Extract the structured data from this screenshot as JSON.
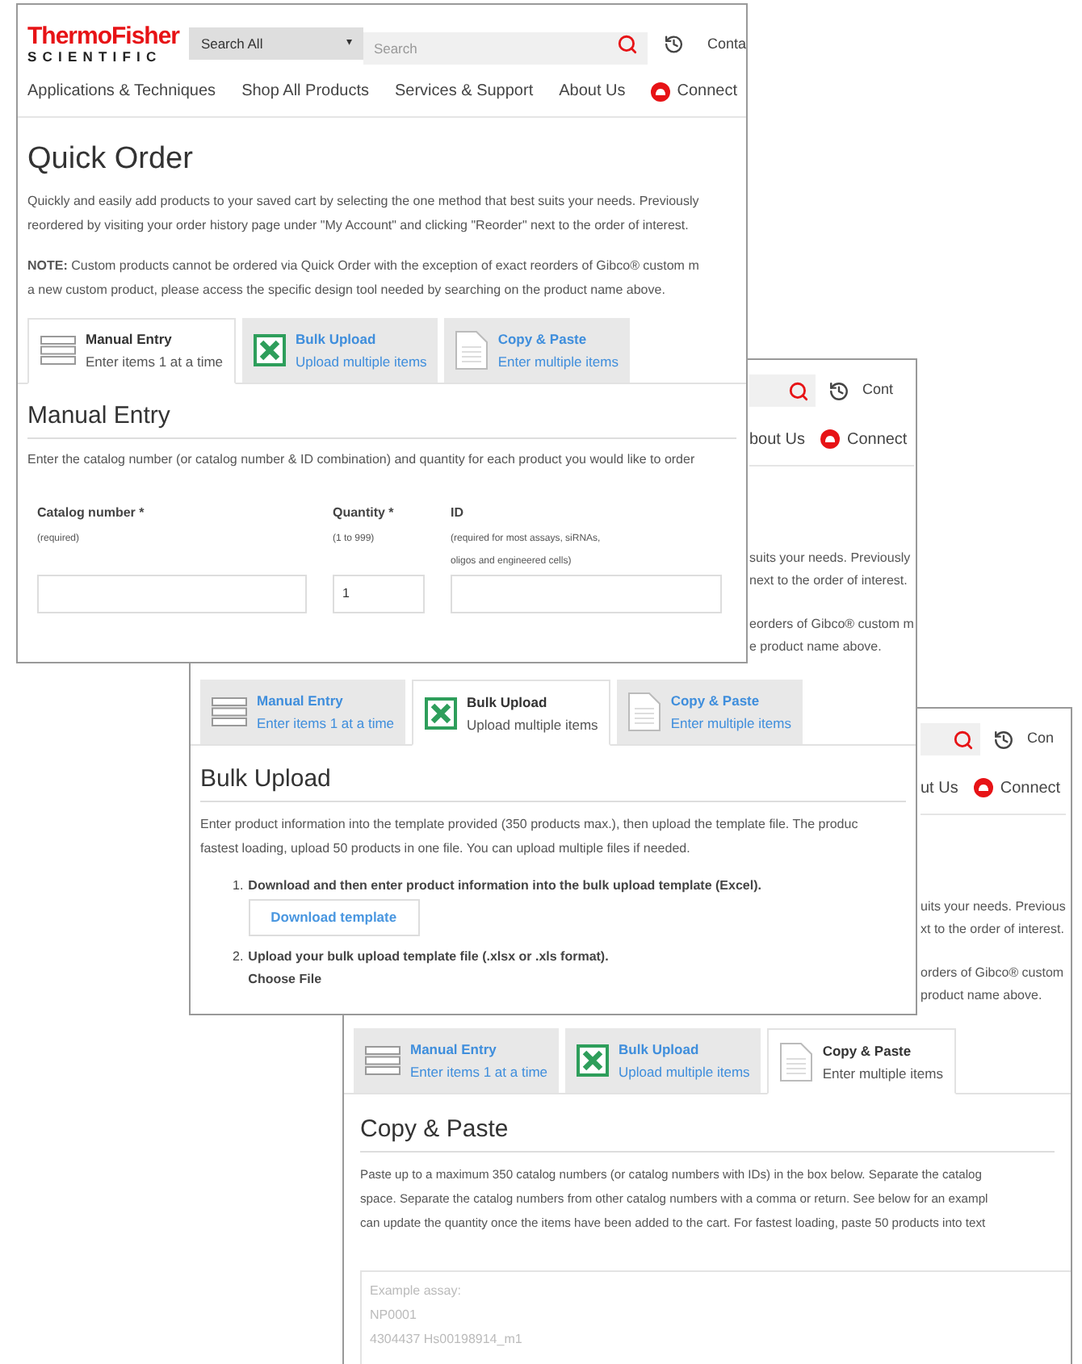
{
  "quick_order_window": {
    "logo": {
      "brand": "ThermoFisher",
      "sub": "SCIENTIFIC"
    },
    "search": {
      "scope": "Search All",
      "caret": "▾",
      "placeholder": "Search"
    },
    "header_link": "Conta",
    "nav": [
      {
        "label": "Applications & Techniques",
        "kind": "link"
      },
      {
        "label": "Shop All Products",
        "kind": "link"
      },
      {
        "label": "Services & Support",
        "kind": "link"
      },
      {
        "label": "About Us",
        "kind": "link"
      },
      {
        "label": "Connect",
        "kind": "connect"
      }
    ],
    "title": "Quick Order",
    "intro_lines": [
      "Quickly and easily add products to your saved cart by selecting the one method that best suits your needs. Previously",
      "reordered by visiting your order history page under \"My Account\" and clicking \"Reorder\" next to the order of interest."
    ],
    "note_lines": [
      "**NOTE:** Custom products cannot be ordered via Quick Order with the exception of exact reorders of Gibco® custom m",
      "a new custom product, please access the specific design tool needed by searching on the product name above."
    ],
    "tabs": [
      {
        "title": "Manual Entry",
        "subtitle": "Enter items 1 at a time",
        "kind": "list",
        "selected": true
      },
      {
        "title": "Bulk Upload",
        "subtitle": "Upload multiple items",
        "kind": "excel",
        "selected": false
      },
      {
        "title": "Copy & Paste",
        "subtitle": "Enter multiple items",
        "kind": "document",
        "selected": false
      }
    ],
    "section_title": "Manual Entry",
    "section_lines": [
      "Enter the catalog number (or catalog number & ID combination) and quantity for each product you would like to order"
    ],
    "fields": [
      {
        "label": "Catalog number *",
        "hint_lines": [
          "(required)"
        ]
      },
      {
        "label": "Quantity *",
        "hint_lines": [
          "(1 to 999)"
        ],
        "value": "1"
      },
      {
        "label": "ID",
        "hint_lines": [
          "(required for most assays, siRNAs,",
          "oligos and engineered cells)"
        ]
      }
    ]
  },
  "bulk_upload_window": {
    "fragment": {
      "header_link": "Cont",
      "nav": [
        {
          "label": "bout Us",
          "kind": "link"
        },
        {
          "label": "Connect",
          "kind": "connect"
        }
      ],
      "lines": [
        "suits your needs. Previously",
        "next to the order of interest.",
        "eorders of Gibco® custom m",
        "e product name above."
      ]
    },
    "tabs": [
      {
        "title": "Manual Entry",
        "subtitle": "Enter items 1 at a time",
        "kind": "list",
        "selected": false
      },
      {
        "title": "Bulk Upload",
        "subtitle": "Upload multiple items",
        "kind": "excel",
        "selected": true
      },
      {
        "title": "Copy & Paste",
        "subtitle": "Enter multiple items",
        "kind": "document",
        "selected": false
      }
    ],
    "section_title": "Bulk Upload",
    "section_lines": [
      "Enter product information into the template provided (350 products max.), then upload the template file. The produc",
      "fastest loading, upload 50 products in one file. You can upload multiple files if needed."
    ],
    "steps": [
      {
        "number": "1.",
        "text": "Download and then enter product information into the bulk upload template (Excel).",
        "button": "Download template"
      },
      {
        "number": "2.",
        "text": "Upload your bulk upload template file (.xlsx or .xls format).",
        "file_button": "Choose File"
      }
    ]
  },
  "copy_paste_window": {
    "fragment": {
      "header_link": "Con",
      "nav": [
        {
          "label": "ut Us",
          "kind": "link"
        },
        {
          "label": "Connect",
          "kind": "connect"
        }
      ],
      "lines": [
        "uits your needs. Previous",
        "xt to the order of interest.",
        "orders of Gibco® custom",
        "product name above."
      ]
    },
    "tabs": [
      {
        "title": "Manual Entry",
        "subtitle": "Enter items 1 at a time",
        "kind": "list",
        "selected": false
      },
      {
        "title": "Bulk Upload",
        "subtitle": "Upload multiple items",
        "kind": "excel",
        "selected": false
      },
      {
        "title": "Copy & Paste",
        "subtitle": "Enter multiple items",
        "kind": "document",
        "selected": true
      }
    ],
    "section_title": "Copy & Paste",
    "section_lines": [
      "Paste up to a maximum 350 catalog numbers (or catalog numbers with IDs) in the box below. Separate the catalog",
      "space. Separate the catalog numbers from other catalog numbers with a comma or return. See below for an exampl",
      "can update the quantity once the items have been added to the cart. For fastest loading, paste 50 products into text"
    ],
    "placeholder": "Example assay:\nNP0001\n4304437 Hs00198914_m1"
  }
}
